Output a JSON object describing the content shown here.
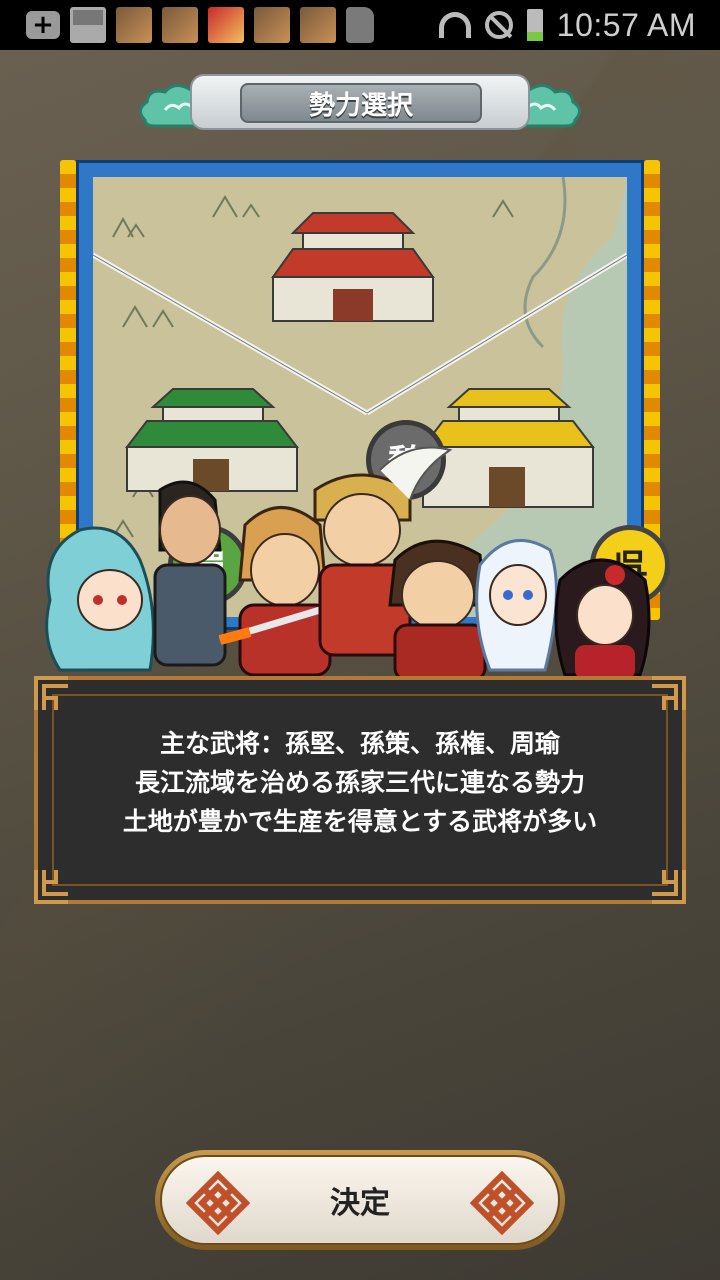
{
  "status_bar": {
    "time": "10:57 AM",
    "notification_icons": [
      "add-icon",
      "image-icon",
      "app-icon",
      "app-icon",
      "app-icon",
      "app-icon",
      "app-icon",
      "sd-card-icon"
    ],
    "system_icons": [
      "wifi-icon",
      "blocked-icon",
      "battery-charging-icon"
    ]
  },
  "header": {
    "title": "勢力選択"
  },
  "map": {
    "factions": [
      {
        "id": "wei",
        "label": "魏",
        "color": "#6b6b6b"
      },
      {
        "id": "shu",
        "label": "蜀",
        "color": "#5aa542"
      },
      {
        "id": "wu",
        "label": "呉",
        "color": "#f4cf19"
      }
    ]
  },
  "description": {
    "lines": [
      "主な武将：孫堅、孫策、孫権、周瑜",
      "長江流域を治める孫家三代に連なる勢力",
      "土地が豊かで生産を得意とする武将が多い"
    ]
  },
  "decide_button": {
    "label": "決定"
  }
}
